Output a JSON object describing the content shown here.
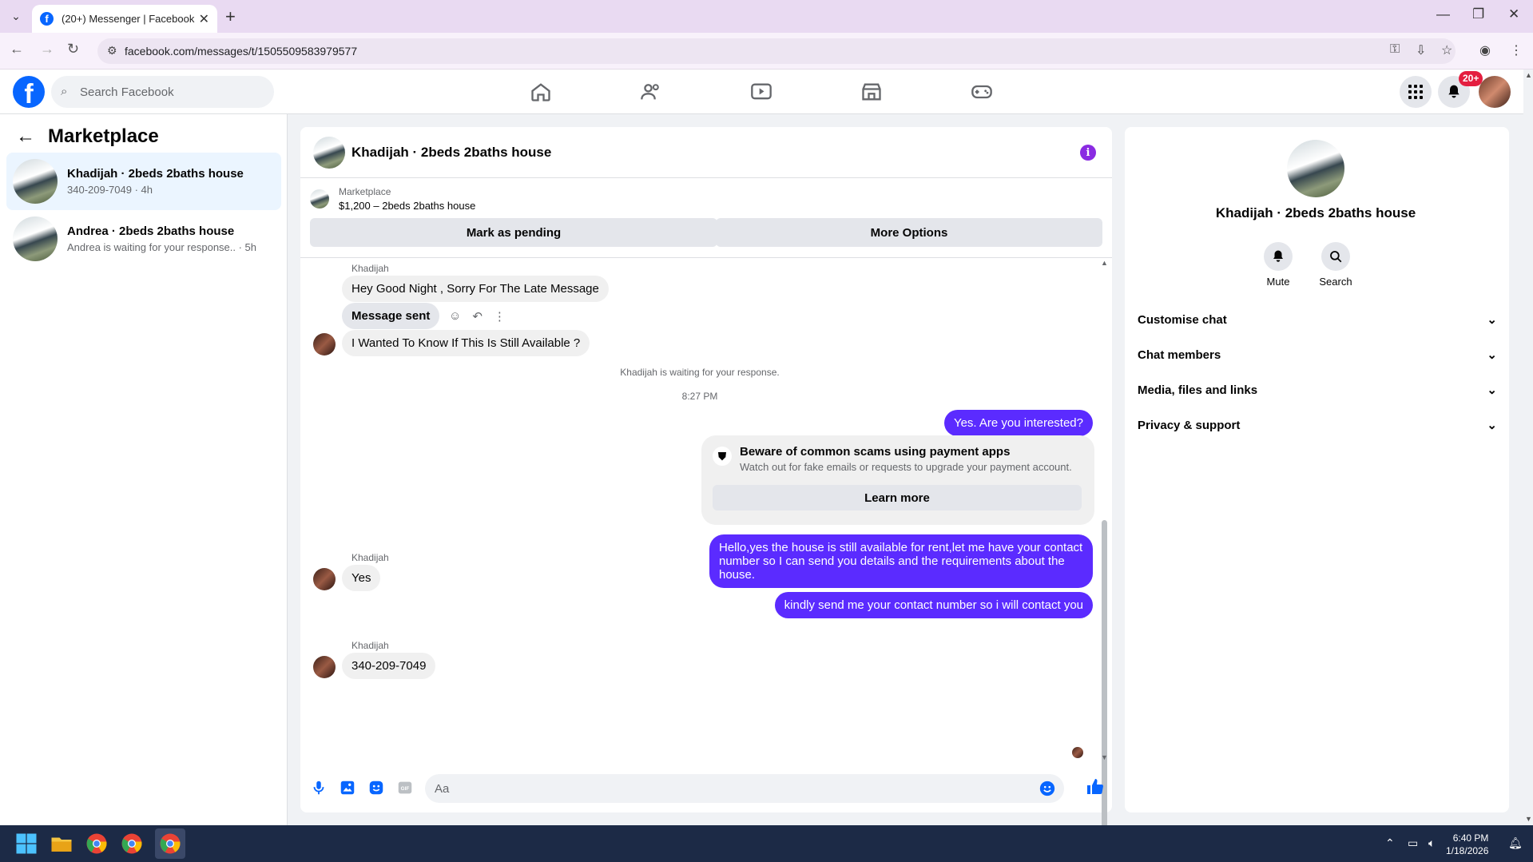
{
  "browser": {
    "tab_title": "(20+) Messenger | Facebook",
    "url": "facebook.com/messages/t/1505509583979577"
  },
  "fb": {
    "search_placeholder": "Search Facebook",
    "notif_count": "20+"
  },
  "sidebar": {
    "title": "Marketplace",
    "threads": [
      {
        "name": "Khadijah · 2beds 2baths house",
        "sub": "340-209-7049 · 4h",
        "active": true
      },
      {
        "name": "Andrea · 2beds 2baths house",
        "sub": "Andrea is waiting for your response.. · 5h",
        "active": false
      }
    ]
  },
  "chat": {
    "header_name": "Khadijah · 2beds 2baths house",
    "marketplace_label": "Marketplace",
    "listing": "$1,200 – 2beds 2baths house",
    "btn_pending": "Mark as pending",
    "btn_options": "More Options",
    "messages": {
      "sender1": "Khadijah",
      "m1": "Hey Good Night , Sorry For The Late Message",
      "m2": "Message sent",
      "m3": "I Wanted To Know If This Is Still Available ?",
      "waiting": "Khadijah is waiting for your response.",
      "time": "8:27 PM",
      "o1": "Yes. Are you interested?",
      "scam_title": "Beware of common scams using payment apps",
      "scam_desc": "Watch out for fake emails or requests to upgrade your payment account.",
      "learn_more": "Learn more",
      "o2": "Hello,yes the house is still available for rent,let me have your contact number   so I can send you details and the requirements about the house.",
      "sender2": "Khadijah",
      "m4": "Yes",
      "o3": "kindly send me your contact number so i will contact you",
      "sender3": "Khadijah",
      "m5": "340-209-7049"
    },
    "composer_placeholder": "Aa"
  },
  "right": {
    "name": "Khadijah · 2beds 2baths house",
    "mute": "Mute",
    "search": "Search",
    "sections": [
      "Customise chat",
      "Chat members",
      "Media, files and links",
      "Privacy & support"
    ]
  },
  "taskbar": {
    "time": "6:40 PM",
    "date": "1/18/2026"
  },
  "colors": {
    "fb_blue": "#0866ff",
    "outgoing_bubble": "#5b2bff",
    "badge_red": "#e41e3f"
  }
}
